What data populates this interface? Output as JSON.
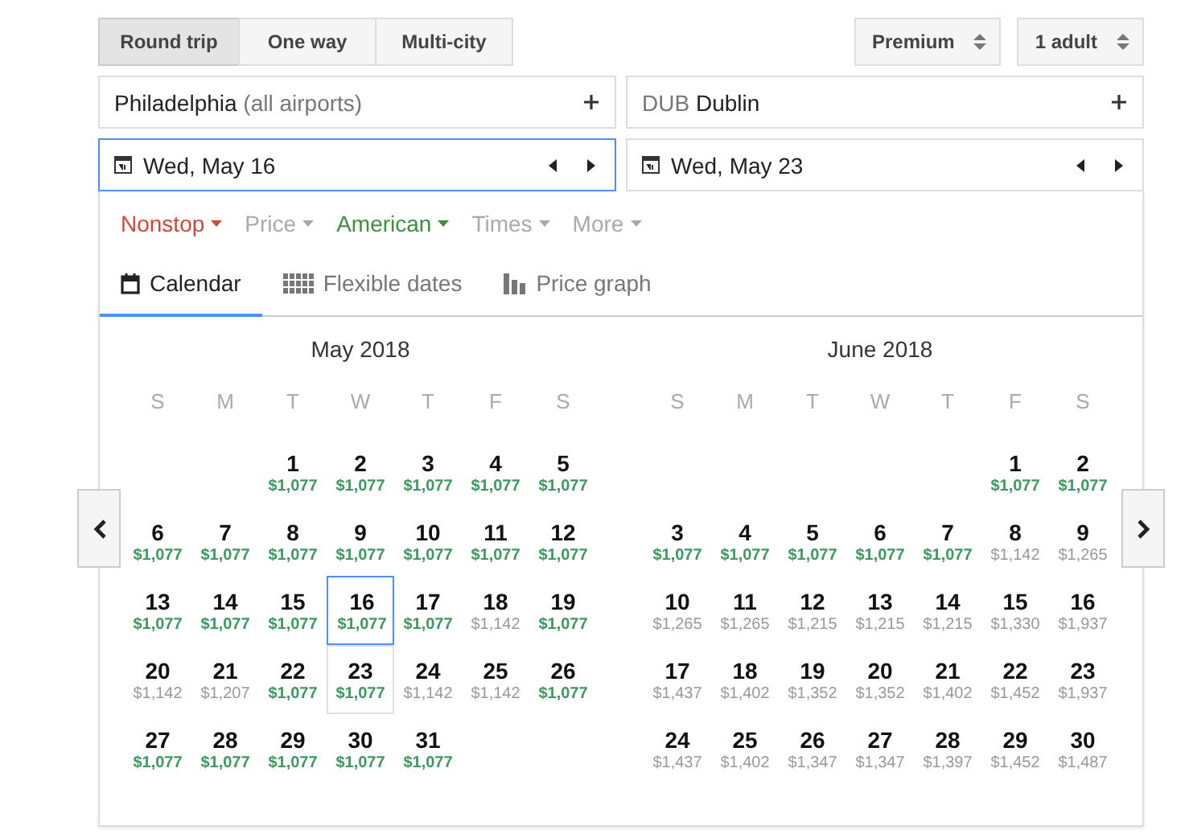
{
  "trip_types": [
    {
      "label": "Round trip",
      "selected": true
    },
    {
      "label": "One way",
      "selected": false
    },
    {
      "label": "Multi-city",
      "selected": false
    }
  ],
  "selectors": [
    {
      "label": "Premium"
    },
    {
      "label": "1 adult"
    }
  ],
  "origin": {
    "value": "Philadelphia",
    "note": "(all airports)"
  },
  "destination": {
    "code": "DUB",
    "value": "Dublin"
  },
  "dates": [
    {
      "value": "Wed, May 16",
      "focused": true
    },
    {
      "value": "Wed, May 23",
      "focused": false
    }
  ],
  "filters": [
    {
      "label": "Nonstop",
      "color": "#d14836"
    },
    {
      "label": "Price",
      "color": "#aaaaaa"
    },
    {
      "label": "American",
      "color": "#3d8f3d"
    },
    {
      "label": "Times",
      "color": "#aaaaaa"
    },
    {
      "label": "More",
      "color": "#aaaaaa"
    }
  ],
  "views": [
    {
      "label": "Calendar",
      "kind": "calendar",
      "selected": true
    },
    {
      "label": "Flexible dates",
      "kind": "grid",
      "selected": false
    },
    {
      "label": "Price graph",
      "kind": "bars",
      "selected": false
    }
  ],
  "months": [
    {
      "title": "May 2018",
      "weekdays": [
        "S",
        "M",
        "T",
        "W",
        "T",
        "F",
        "S"
      ],
      "weeks": [
        [
          {
            "day": "1",
            "price": "$1,077",
            "cheap": true,
            "selected": false,
            "return": false
          },
          {
            "day": "2",
            "price": "$1,077",
            "cheap": true,
            "selected": false,
            "return": false
          },
          {
            "day": "3",
            "price": "$1,077",
            "cheap": true,
            "selected": false,
            "return": false
          },
          {
            "day": "4",
            "price": "$1,077",
            "cheap": true,
            "selected": false,
            "return": false
          },
          {
            "day": "5",
            "price": "$1,077",
            "cheap": true,
            "selected": false,
            "return": false
          }
        ],
        [
          {
            "day": "6",
            "price": "$1,077",
            "cheap": true,
            "selected": false,
            "return": false
          },
          {
            "day": "7",
            "price": "$1,077",
            "cheap": true,
            "selected": false,
            "return": false
          },
          {
            "day": "8",
            "price": "$1,077",
            "cheap": true,
            "selected": false,
            "return": false
          },
          {
            "day": "9",
            "price": "$1,077",
            "cheap": true,
            "selected": false,
            "return": false
          },
          {
            "day": "10",
            "price": "$1,077",
            "cheap": true,
            "selected": false,
            "return": false
          },
          {
            "day": "11",
            "price": "$1,077",
            "cheap": true,
            "selected": false,
            "return": false
          },
          {
            "day": "12",
            "price": "$1,077",
            "cheap": true,
            "selected": false,
            "return": false
          }
        ],
        [
          {
            "day": "13",
            "price": "$1,077",
            "cheap": true,
            "selected": false,
            "return": false
          },
          {
            "day": "14",
            "price": "$1,077",
            "cheap": true,
            "selected": false,
            "return": false
          },
          {
            "day": "15",
            "price": "$1,077",
            "cheap": true,
            "selected": false,
            "return": false
          },
          {
            "day": "16",
            "price": "$1,077",
            "cheap": true,
            "selected": true,
            "return": false
          },
          {
            "day": "17",
            "price": "$1,077",
            "cheap": true,
            "selected": false,
            "return": false
          },
          {
            "day": "18",
            "price": "$1,142",
            "cheap": false,
            "selected": false,
            "return": false
          },
          {
            "day": "19",
            "price": "$1,077",
            "cheap": true,
            "selected": false,
            "return": false
          }
        ],
        [
          {
            "day": "20",
            "price": "$1,142",
            "cheap": false,
            "selected": false,
            "return": false
          },
          {
            "day": "21",
            "price": "$1,207",
            "cheap": false,
            "selected": false,
            "return": false
          },
          {
            "day": "22",
            "price": "$1,077",
            "cheap": true,
            "selected": false,
            "return": false
          },
          {
            "day": "23",
            "price": "$1,077",
            "cheap": true,
            "selected": false,
            "return": true
          },
          {
            "day": "24",
            "price": "$1,142",
            "cheap": false,
            "selected": false,
            "return": false
          },
          {
            "day": "25",
            "price": "$1,142",
            "cheap": false,
            "selected": false,
            "return": false
          },
          {
            "day": "26",
            "price": "$1,077",
            "cheap": true,
            "selected": false,
            "return": false
          }
        ],
        [
          {
            "day": "27",
            "price": "$1,077",
            "cheap": true,
            "selected": false,
            "return": false
          },
          {
            "day": "28",
            "price": "$1,077",
            "cheap": true,
            "selected": false,
            "return": false
          },
          {
            "day": "29",
            "price": "$1,077",
            "cheap": true,
            "selected": false,
            "return": false
          },
          {
            "day": "30",
            "price": "$1,077",
            "cheap": true,
            "selected": false,
            "return": false
          },
          {
            "day": "31",
            "price": "$1,077",
            "cheap": true,
            "selected": false,
            "return": false
          }
        ]
      ]
    },
    {
      "title": "June 2018",
      "weekdays": [
        "S",
        "M",
        "T",
        "W",
        "T",
        "F",
        "S"
      ],
      "weeks": [
        [
          {
            "day": "1",
            "price": "$1,077",
            "cheap": true,
            "selected": false,
            "return": false
          },
          {
            "day": "2",
            "price": "$1,077",
            "cheap": true,
            "selected": false,
            "return": false
          }
        ],
        [
          {
            "day": "3",
            "price": "$1,077",
            "cheap": true,
            "selected": false,
            "return": false
          },
          {
            "day": "4",
            "price": "$1,077",
            "cheap": true,
            "selected": false,
            "return": false
          },
          {
            "day": "5",
            "price": "$1,077",
            "cheap": true,
            "selected": false,
            "return": false
          },
          {
            "day": "6",
            "price": "$1,077",
            "cheap": true,
            "selected": false,
            "return": false
          },
          {
            "day": "7",
            "price": "$1,077",
            "cheap": true,
            "selected": false,
            "return": false
          },
          {
            "day": "8",
            "price": "$1,142",
            "cheap": false,
            "selected": false,
            "return": false
          },
          {
            "day": "9",
            "price": "$1,265",
            "cheap": false,
            "selected": false,
            "return": false
          }
        ],
        [
          {
            "day": "10",
            "price": "$1,265",
            "cheap": false,
            "selected": false,
            "return": false
          },
          {
            "day": "11",
            "price": "$1,265",
            "cheap": false,
            "selected": false,
            "return": false
          },
          {
            "day": "12",
            "price": "$1,215",
            "cheap": false,
            "selected": false,
            "return": false
          },
          {
            "day": "13",
            "price": "$1,215",
            "cheap": false,
            "selected": false,
            "return": false
          },
          {
            "day": "14",
            "price": "$1,215",
            "cheap": false,
            "selected": false,
            "return": false
          },
          {
            "day": "15",
            "price": "$1,330",
            "cheap": false,
            "selected": false,
            "return": false
          },
          {
            "day": "16",
            "price": "$1,937",
            "cheap": false,
            "selected": false,
            "return": false
          }
        ],
        [
          {
            "day": "17",
            "price": "$1,437",
            "cheap": false,
            "selected": false,
            "return": false
          },
          {
            "day": "18",
            "price": "$1,402",
            "cheap": false,
            "selected": false,
            "return": false
          },
          {
            "day": "19",
            "price": "$1,352",
            "cheap": false,
            "selected": false,
            "return": false
          },
          {
            "day": "20",
            "price": "$1,352",
            "cheap": false,
            "selected": false,
            "return": false
          },
          {
            "day": "21",
            "price": "$1,402",
            "cheap": false,
            "selected": false,
            "return": false
          },
          {
            "day": "22",
            "price": "$1,452",
            "cheap": false,
            "selected": false,
            "return": false
          },
          {
            "day": "23",
            "price": "$1,937",
            "cheap": false,
            "selected": false,
            "return": false
          }
        ],
        [
          {
            "day": "24",
            "price": "$1,437",
            "cheap": false,
            "selected": false,
            "return": false
          },
          {
            "day": "25",
            "price": "$1,402",
            "cheap": false,
            "selected": false,
            "return": false
          },
          {
            "day": "26",
            "price": "$1,347",
            "cheap": false,
            "selected": false,
            "return": false
          },
          {
            "day": "27",
            "price": "$1,347",
            "cheap": false,
            "selected": false,
            "return": false
          },
          {
            "day": "28",
            "price": "$1,397",
            "cheap": false,
            "selected": false,
            "return": false
          },
          {
            "day": "29",
            "price": "$1,452",
            "cheap": false,
            "selected": false,
            "return": false
          },
          {
            "day": "30",
            "price": "$1,487",
            "cheap": false,
            "selected": false,
            "return": false
          }
        ]
      ]
    }
  ]
}
